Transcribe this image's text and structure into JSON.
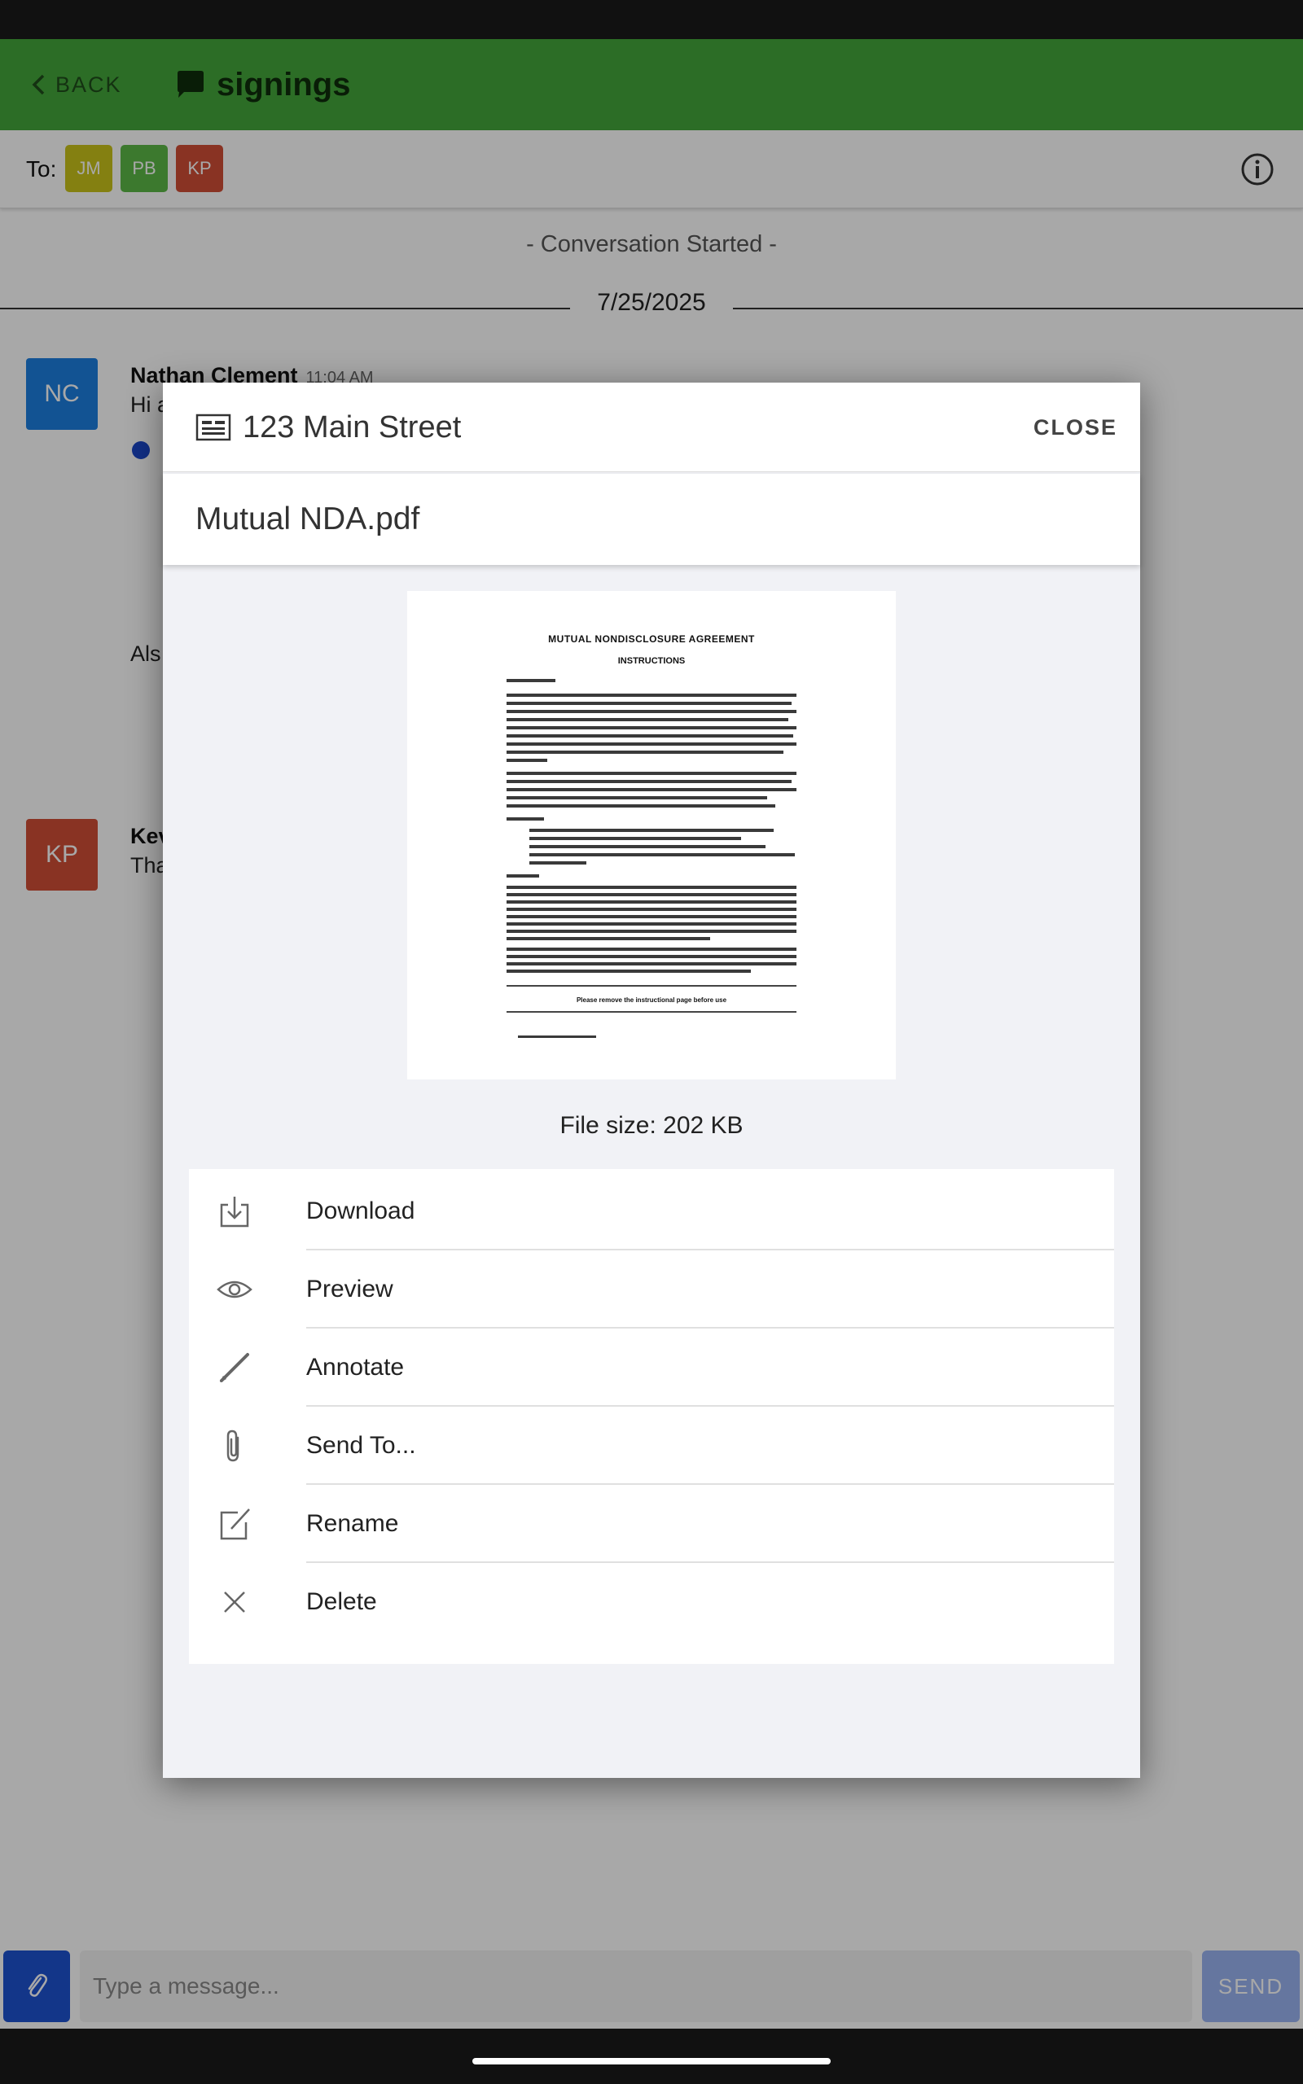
{
  "app": {
    "back_label": "BACK",
    "title": "signings",
    "header_color": "#44a63b"
  },
  "recipients": {
    "label": "To:",
    "chips": [
      {
        "initials": "JM",
        "color": "#c9c21a"
      },
      {
        "initials": "PB",
        "color": "#5cb846"
      },
      {
        "initials": "KP",
        "color": "#d04e36"
      }
    ]
  },
  "conversation": {
    "started_text": "- Conversation Started -",
    "date": "7/25/2025",
    "messages": [
      {
        "initials": "NC",
        "avatar_color": "#1c7fe0",
        "name": "Nathan Clement",
        "time": "11:04 AM",
        "text": "Hi a",
        "extra_text": "Als"
      },
      {
        "initials": "KP",
        "avatar_color": "#d04e36",
        "name": "Kev",
        "text": "Tha"
      }
    ]
  },
  "composer": {
    "placeholder": "Type a message...",
    "send_label": "SEND"
  },
  "modal": {
    "title": "123 Main Street",
    "close_label": "CLOSE",
    "file_name": "Mutual NDA.pdf",
    "document": {
      "title": "MUTUAL NONDISCLOSURE AGREEMENT",
      "subtitle": "INSTRUCTIONS",
      "footer": "Please remove the instructional page before use"
    },
    "file_size": "File size: 202 KB",
    "actions": [
      {
        "label": "Download",
        "icon": "download-icon"
      },
      {
        "label": "Preview",
        "icon": "eye-icon"
      },
      {
        "label": "Annotate",
        "icon": "pencil-icon"
      },
      {
        "label": "Send To...",
        "icon": "paperclip-icon"
      },
      {
        "label": "Rename",
        "icon": "edit-square-icon"
      },
      {
        "label": "Delete",
        "icon": "close-icon"
      }
    ]
  }
}
